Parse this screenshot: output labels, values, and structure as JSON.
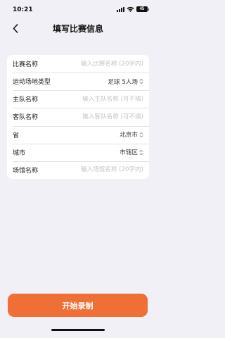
{
  "status_bar": {
    "time": "10:21",
    "battery": "45"
  },
  "nav": {
    "title": "填写比赛信息",
    "back_icon": "chevron-left-icon"
  },
  "form": {
    "rows": [
      {
        "label": "比赛名称",
        "type": "input",
        "value": "",
        "placeholder": "输入比赛名称 (20字内)"
      },
      {
        "label": "运动场地类型",
        "type": "select",
        "value": "足球 5人场"
      },
      {
        "label": "主队名称",
        "type": "input",
        "value": "",
        "placeholder": "输入主队名称 (可不填)"
      },
      {
        "label": "客队名称",
        "type": "input",
        "value": "",
        "placeholder": "输入客队名称 (可不填)"
      },
      {
        "label": "省",
        "type": "select",
        "value": "北京市"
      },
      {
        "label": "城市",
        "type": "select",
        "value": "市辖区"
      },
      {
        "label": "场馆名称",
        "type": "input",
        "value": "",
        "placeholder": "输入场馆名称 (20字内)"
      }
    ]
  },
  "actions": {
    "start_label": "开始录制"
  },
  "colors": {
    "accent": "#ef6f37",
    "background": "#f1f0f6"
  }
}
